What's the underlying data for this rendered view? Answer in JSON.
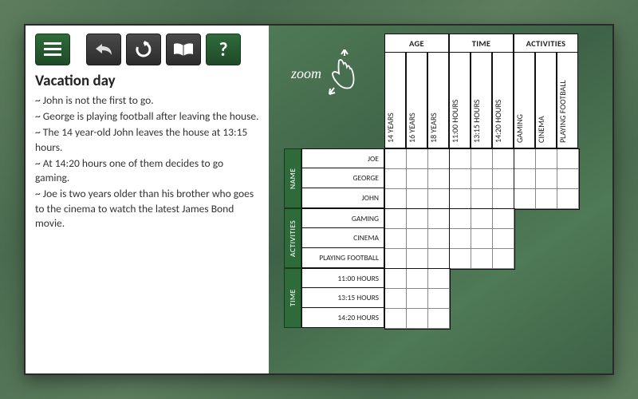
{
  "toolbar": {
    "menu": "≡",
    "undo": "↶",
    "restart": "↻",
    "book": "📖",
    "help": "?"
  },
  "puzzle": {
    "title": "Vacation day",
    "clues": [
      "~ John is not the first to go.",
      "~ George is playing football after leaving the house.",
      "~ The 14 year-old John leaves the house at 13:15 hours.",
      "~ At 14:20 hours one of them decides to go gaming.",
      "~ Joe is two years older than his brother who goes to the cinema to watch the latest James Bond movie."
    ]
  },
  "zoom_label": "zoom",
  "grid": {
    "col_groups": [
      "AGE",
      "TIME",
      "ACTIVITIES"
    ],
    "cols": {
      "AGE": [
        "14 YEARS",
        "16 YEARS",
        "18 YEARS"
      ],
      "TIME": [
        "11:00 HOURS",
        "13:15 HOURS",
        "14:20 HOURS"
      ],
      "ACTIVITIES": [
        "GAMING",
        "CINEMA",
        "PLAYING FOOTBALL"
      ]
    },
    "row_groups": [
      "NAME",
      "ACTIVITIES",
      "TIME"
    ],
    "rows": {
      "NAME": [
        "JOE",
        "GEORGE",
        "JOHN"
      ],
      "ACTIVITIES": [
        "GAMING",
        "CINEMA",
        "PLAYING FOOTBALL"
      ],
      "TIME": [
        "11:00 HOURS",
        "13:15 HOURS",
        "14:20 HOURS"
      ]
    }
  }
}
